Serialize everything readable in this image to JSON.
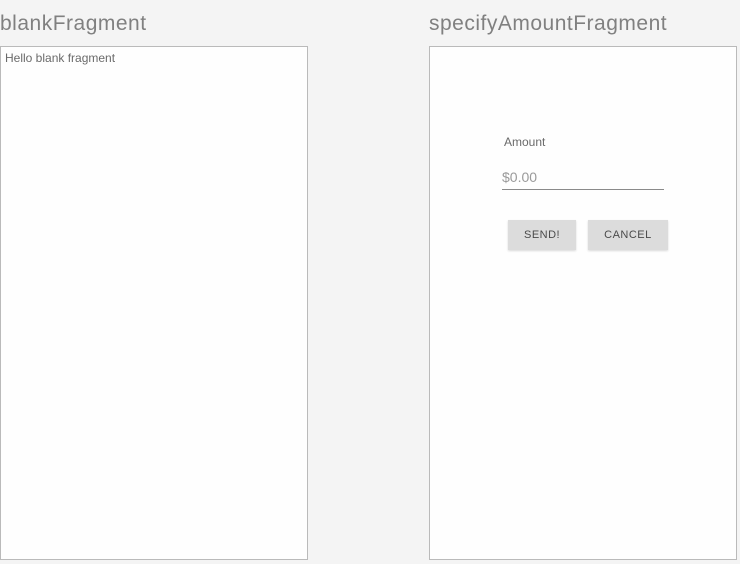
{
  "left": {
    "title": "blankFragment",
    "body_text": "Hello blank fragment"
  },
  "right": {
    "title": "specifyAmountFragment",
    "amount_label": "Amount",
    "amount_placeholder": "$0.00",
    "send_label": "SEND!",
    "cancel_label": "CANCEL"
  }
}
